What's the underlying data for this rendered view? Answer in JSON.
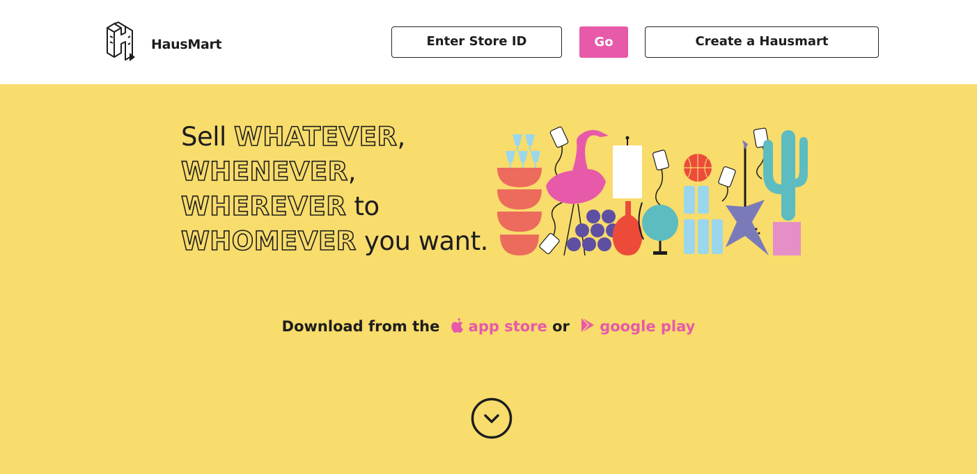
{
  "header": {
    "brand": "HausMart",
    "store_id_placeholder": "Enter Store ID",
    "go_label": "Go",
    "create_label": "Create a Hausmart"
  },
  "hero": {
    "headline": {
      "sell": "Sell ",
      "whatever": "WHATEVER",
      "comma1": ",",
      "whenever": "WHENEVER",
      "comma2": ",",
      "wherever": "WHEREVER",
      "to": " to",
      "whomever": "WHOMEVER",
      "you_want": " you want."
    },
    "download": {
      "prefix": "Download from the",
      "app_store": "app store",
      "or": "or",
      "google_play": "google play"
    }
  },
  "colors": {
    "background_yellow": "#f8dc6c",
    "accent_pink": "#e759a9",
    "text_dark": "#1d1d1d",
    "header_white": "#ffffff"
  },
  "icons": [
    "logo-icon",
    "apple-icon",
    "google-play-icon",
    "chevron-down-circle-icon"
  ]
}
